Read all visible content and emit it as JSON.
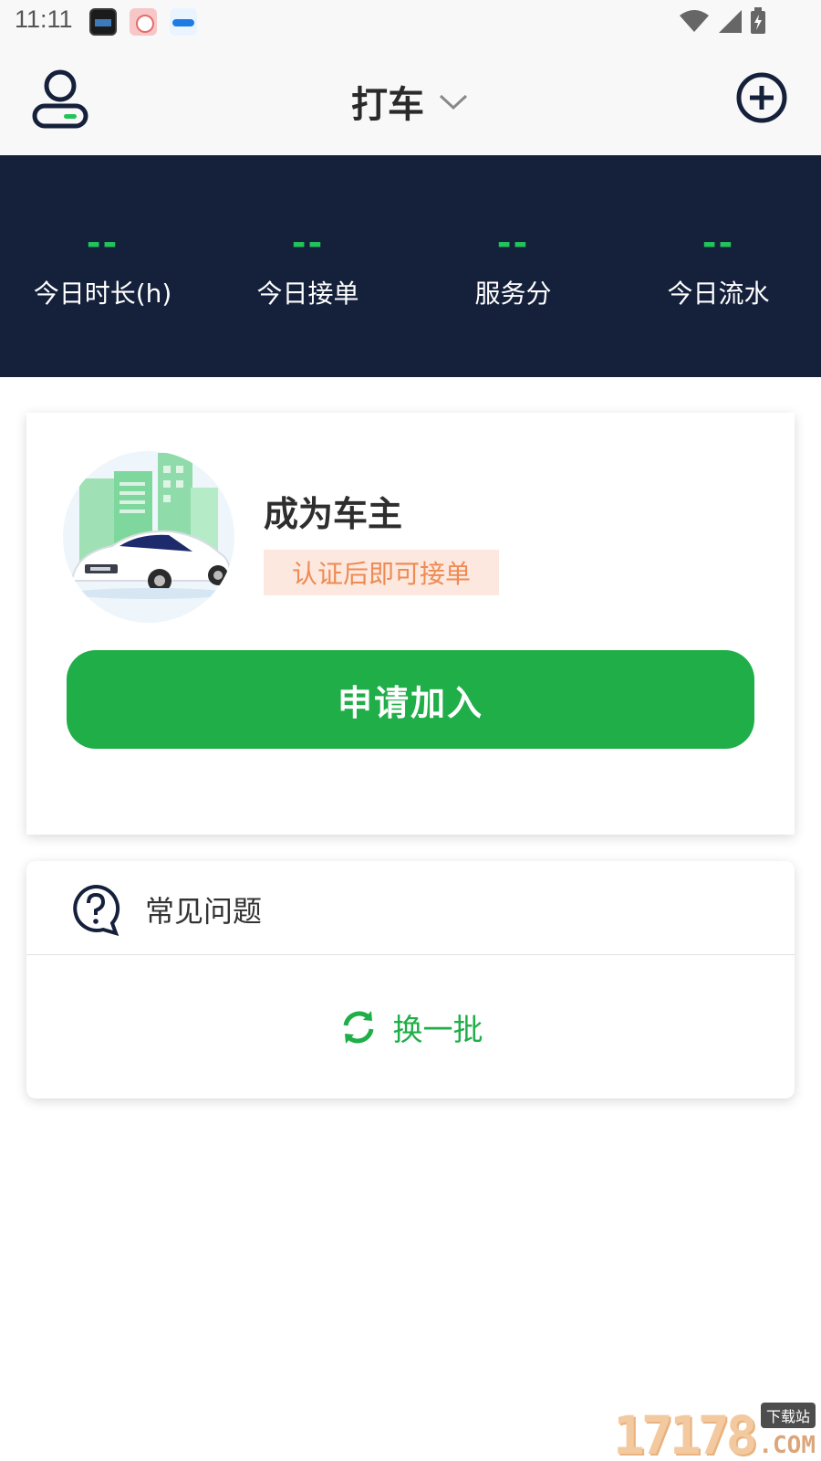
{
  "status_bar": {
    "time": "11:11",
    "icons": [
      "app-icon",
      "app-icon",
      "app-icon",
      "wifi-icon",
      "signal-icon",
      "battery-charging-icon"
    ]
  },
  "header": {
    "title": "打车",
    "left_icon": "user-profile-icon",
    "right_icon": "add-circle-icon"
  },
  "stats": [
    {
      "value": "--",
      "label": "今日时长(h)"
    },
    {
      "value": "--",
      "label": "今日接单"
    },
    {
      "value": "--",
      "label": "服务分"
    },
    {
      "value": "--",
      "label": "今日流水"
    }
  ],
  "owner_card": {
    "title": "成为车主",
    "tag": "认证后即可接单",
    "button": "申请加入"
  },
  "faq_card": {
    "title": "常见问题",
    "refresh_label": "换一批"
  },
  "watermark": {
    "number": "17178",
    "badge": "下载站",
    "suffix": ".COM"
  },
  "colors": {
    "banner_bg": "#15203b",
    "stat_value": "#22c35a",
    "primary_green": "#1fae48",
    "tag_bg": "#fde8df",
    "tag_text": "#ee8a52"
  }
}
